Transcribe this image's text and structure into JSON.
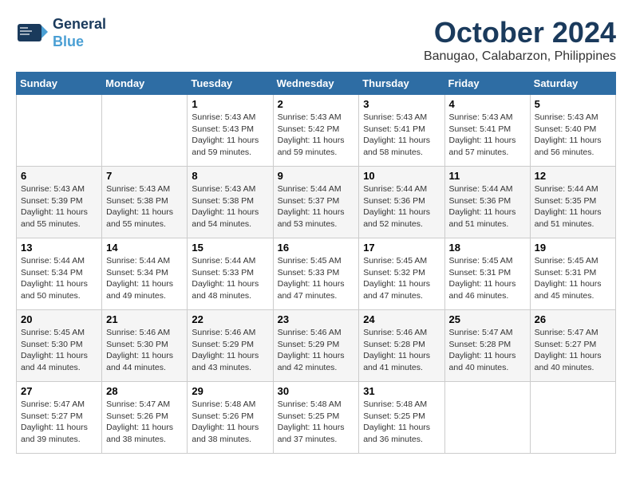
{
  "logo": {
    "line1": "General",
    "line2": "Blue"
  },
  "title": {
    "month": "October 2024",
    "location": "Banugao, Calabarzon, Philippines"
  },
  "days_of_week": [
    "Sunday",
    "Monday",
    "Tuesday",
    "Wednesday",
    "Thursday",
    "Friday",
    "Saturday"
  ],
  "weeks": [
    [
      {
        "day": "",
        "sunrise": "",
        "sunset": "",
        "daylight": ""
      },
      {
        "day": "",
        "sunrise": "",
        "sunset": "",
        "daylight": ""
      },
      {
        "day": "1",
        "sunrise": "Sunrise: 5:43 AM",
        "sunset": "Sunset: 5:43 PM",
        "daylight": "Daylight: 11 hours and 59 minutes."
      },
      {
        "day": "2",
        "sunrise": "Sunrise: 5:43 AM",
        "sunset": "Sunset: 5:42 PM",
        "daylight": "Daylight: 11 hours and 59 minutes."
      },
      {
        "day": "3",
        "sunrise": "Sunrise: 5:43 AM",
        "sunset": "Sunset: 5:41 PM",
        "daylight": "Daylight: 11 hours and 58 minutes."
      },
      {
        "day": "4",
        "sunrise": "Sunrise: 5:43 AM",
        "sunset": "Sunset: 5:41 PM",
        "daylight": "Daylight: 11 hours and 57 minutes."
      },
      {
        "day": "5",
        "sunrise": "Sunrise: 5:43 AM",
        "sunset": "Sunset: 5:40 PM",
        "daylight": "Daylight: 11 hours and 56 minutes."
      }
    ],
    [
      {
        "day": "6",
        "sunrise": "Sunrise: 5:43 AM",
        "sunset": "Sunset: 5:39 PM",
        "daylight": "Daylight: 11 hours and 55 minutes."
      },
      {
        "day": "7",
        "sunrise": "Sunrise: 5:43 AM",
        "sunset": "Sunset: 5:38 PM",
        "daylight": "Daylight: 11 hours and 55 minutes."
      },
      {
        "day": "8",
        "sunrise": "Sunrise: 5:43 AM",
        "sunset": "Sunset: 5:38 PM",
        "daylight": "Daylight: 11 hours and 54 minutes."
      },
      {
        "day": "9",
        "sunrise": "Sunrise: 5:44 AM",
        "sunset": "Sunset: 5:37 PM",
        "daylight": "Daylight: 11 hours and 53 minutes."
      },
      {
        "day": "10",
        "sunrise": "Sunrise: 5:44 AM",
        "sunset": "Sunset: 5:36 PM",
        "daylight": "Daylight: 11 hours and 52 minutes."
      },
      {
        "day": "11",
        "sunrise": "Sunrise: 5:44 AM",
        "sunset": "Sunset: 5:36 PM",
        "daylight": "Daylight: 11 hours and 51 minutes."
      },
      {
        "day": "12",
        "sunrise": "Sunrise: 5:44 AM",
        "sunset": "Sunset: 5:35 PM",
        "daylight": "Daylight: 11 hours and 51 minutes."
      }
    ],
    [
      {
        "day": "13",
        "sunrise": "Sunrise: 5:44 AM",
        "sunset": "Sunset: 5:34 PM",
        "daylight": "Daylight: 11 hours and 50 minutes."
      },
      {
        "day": "14",
        "sunrise": "Sunrise: 5:44 AM",
        "sunset": "Sunset: 5:34 PM",
        "daylight": "Daylight: 11 hours and 49 minutes."
      },
      {
        "day": "15",
        "sunrise": "Sunrise: 5:44 AM",
        "sunset": "Sunset: 5:33 PM",
        "daylight": "Daylight: 11 hours and 48 minutes."
      },
      {
        "day": "16",
        "sunrise": "Sunrise: 5:45 AM",
        "sunset": "Sunset: 5:33 PM",
        "daylight": "Daylight: 11 hours and 47 minutes."
      },
      {
        "day": "17",
        "sunrise": "Sunrise: 5:45 AM",
        "sunset": "Sunset: 5:32 PM",
        "daylight": "Daylight: 11 hours and 47 minutes."
      },
      {
        "day": "18",
        "sunrise": "Sunrise: 5:45 AM",
        "sunset": "Sunset: 5:31 PM",
        "daylight": "Daylight: 11 hours and 46 minutes."
      },
      {
        "day": "19",
        "sunrise": "Sunrise: 5:45 AM",
        "sunset": "Sunset: 5:31 PM",
        "daylight": "Daylight: 11 hours and 45 minutes."
      }
    ],
    [
      {
        "day": "20",
        "sunrise": "Sunrise: 5:45 AM",
        "sunset": "Sunset: 5:30 PM",
        "daylight": "Daylight: 11 hours and 44 minutes."
      },
      {
        "day": "21",
        "sunrise": "Sunrise: 5:46 AM",
        "sunset": "Sunset: 5:30 PM",
        "daylight": "Daylight: 11 hours and 44 minutes."
      },
      {
        "day": "22",
        "sunrise": "Sunrise: 5:46 AM",
        "sunset": "Sunset: 5:29 PM",
        "daylight": "Daylight: 11 hours and 43 minutes."
      },
      {
        "day": "23",
        "sunrise": "Sunrise: 5:46 AM",
        "sunset": "Sunset: 5:29 PM",
        "daylight": "Daylight: 11 hours and 42 minutes."
      },
      {
        "day": "24",
        "sunrise": "Sunrise: 5:46 AM",
        "sunset": "Sunset: 5:28 PM",
        "daylight": "Daylight: 11 hours and 41 minutes."
      },
      {
        "day": "25",
        "sunrise": "Sunrise: 5:47 AM",
        "sunset": "Sunset: 5:28 PM",
        "daylight": "Daylight: 11 hours and 40 minutes."
      },
      {
        "day": "26",
        "sunrise": "Sunrise: 5:47 AM",
        "sunset": "Sunset: 5:27 PM",
        "daylight": "Daylight: 11 hours and 40 minutes."
      }
    ],
    [
      {
        "day": "27",
        "sunrise": "Sunrise: 5:47 AM",
        "sunset": "Sunset: 5:27 PM",
        "daylight": "Daylight: 11 hours and 39 minutes."
      },
      {
        "day": "28",
        "sunrise": "Sunrise: 5:47 AM",
        "sunset": "Sunset: 5:26 PM",
        "daylight": "Daylight: 11 hours and 38 minutes."
      },
      {
        "day": "29",
        "sunrise": "Sunrise: 5:48 AM",
        "sunset": "Sunset: 5:26 PM",
        "daylight": "Daylight: 11 hours and 38 minutes."
      },
      {
        "day": "30",
        "sunrise": "Sunrise: 5:48 AM",
        "sunset": "Sunset: 5:25 PM",
        "daylight": "Daylight: 11 hours and 37 minutes."
      },
      {
        "day": "31",
        "sunrise": "Sunrise: 5:48 AM",
        "sunset": "Sunset: 5:25 PM",
        "daylight": "Daylight: 11 hours and 36 minutes."
      },
      {
        "day": "",
        "sunrise": "",
        "sunset": "",
        "daylight": ""
      },
      {
        "day": "",
        "sunrise": "",
        "sunset": "",
        "daylight": ""
      }
    ]
  ]
}
